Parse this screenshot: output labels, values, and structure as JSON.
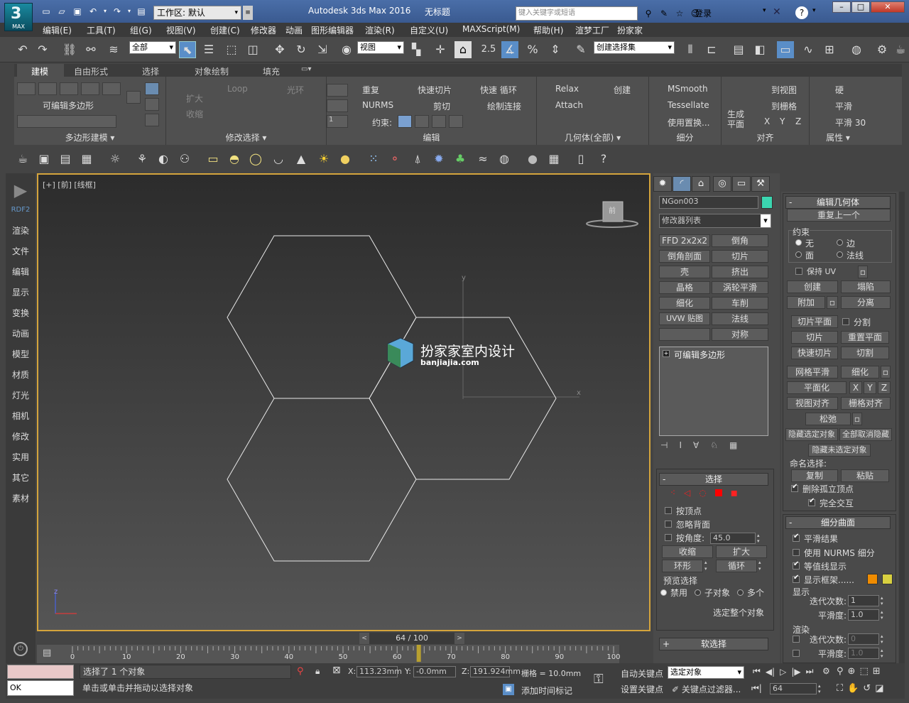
{
  "app": {
    "logo_text": "MAX",
    "title": "Autodesk 3ds Max 2016",
    "document": "无标题",
    "workspace": "工作区: 默认",
    "search_placeholder": "键入关键字或短语",
    "login": "登录"
  },
  "menu": [
    "编辑(E)",
    "工具(T)",
    "组(G)",
    "视图(V)",
    "创建(C)",
    "修改器",
    "动画",
    "图形编辑器",
    "渲染(R)",
    "自定义(U)",
    "MAXScript(M)",
    "帮助(H)",
    "渲梦工厂",
    "扮家家"
  ],
  "toolbar": {
    "filter": "全部",
    "coord": "视图",
    "snap_value": "2.5",
    "named_sel": "创建选择集"
  },
  "ribbon": {
    "tabs": [
      "建模",
      "自由形式",
      "选择",
      "对象绘制",
      "填充"
    ],
    "groups": {
      "poly": "多边形建模",
      "poly_sub": "可编辑多边形",
      "modsel": "修改选择",
      "edit": "编辑",
      "geom": "几何体(全部)",
      "subdiv": "细分",
      "align": "对齐",
      "props": "属性"
    },
    "modsel": {
      "grow": "扩大",
      "shrink": "收缩",
      "loop": "Loop",
      "ring": "光环"
    },
    "edit": {
      "repeat": "重复",
      "quickslice": "快速切片",
      "quickloop": "快速 循环",
      "nurms": "NURMS",
      "cut": "剪切",
      "paintconnect": "绘制连接",
      "constrain": "约束:",
      "spin": "1"
    },
    "geom": {
      "relax": "Relax",
      "create": "创建",
      "attach": "Attach"
    },
    "subdiv": {
      "msmooth": "MSmooth",
      "tessellate": "Tessellate",
      "usedisp": "使用置换..."
    },
    "align": {
      "generate": "生成",
      "plane": "平面",
      "toview": "到视图",
      "togrid": "到栅格",
      "x": "X",
      "y": "Y",
      "z": "Z"
    },
    "props": {
      "hard": "硬",
      "smooth": "平滑",
      "smooth30": "平滑 30"
    }
  },
  "leftbar": [
    "RDF2",
    "渲染",
    "文件",
    "编辑",
    "显示",
    "变换",
    "动画",
    "模型",
    "材质",
    "灯光",
    "相机",
    "修改",
    "实用",
    "其它",
    "素材"
  ],
  "viewport": {
    "label": "[+] [前] [线框]",
    "cube_label": "前",
    "axis_y": "y",
    "axis_x": "x",
    "axis_z": "z",
    "watermark_cn": "扮家家室内设计",
    "watermark_en": "banjiajia.com"
  },
  "cmd": {
    "object_name": "NGon003",
    "object_color": "#3bd6b0",
    "modlist": "修改器列表",
    "modbuttons": [
      "FFD 2x2x2",
      "倒角",
      "倒角剖面",
      "切片",
      "壳",
      "挤出",
      "晶格",
      "涡轮平滑",
      "细化",
      "车削",
      "UVW 贴图",
      "法线",
      "",
      "对称"
    ],
    "stack_item": "可编辑多边形",
    "selection": {
      "title": "选择",
      "by_vertex": "按顶点",
      "ignore_back": "忽略背面",
      "by_angle": "按角度:",
      "angle": "45.0",
      "shrink": "收缩",
      "grow": "扩大",
      "ring": "环形",
      "loop": "循环",
      "preview": "预览选择",
      "disabled": "禁用",
      "subobj": "子对象",
      "multi": "多个",
      "whole": "选定整个对象"
    },
    "soft": "软选择"
  },
  "editgeo": {
    "title": "编辑几何体",
    "repeat": "重复上一个",
    "constraints": "约束",
    "none": "无",
    "edge": "边",
    "face": "面",
    "normal": "法线",
    "keep_uv": "保持 UV",
    "create": "创建",
    "collapse": "塌陷",
    "attach": "附加",
    "detach": "分离",
    "slice_plane": "切片平面",
    "split": "分割",
    "slice": "切片",
    "reset_plane": "重置平面",
    "quickslice": "快速切片",
    "cut": "切割",
    "msmooth": "网格平滑",
    "tessellate": "细化",
    "planar": "平面化",
    "x": "X",
    "y": "Y",
    "z": "Z",
    "view_align": "视图对齐",
    "grid_align": "栅格对齐",
    "relax": "松弛",
    "hide_sel": "隐藏选定对象",
    "unhide_all": "全部取消隐藏",
    "hide_unsel": "隐藏未选定对象",
    "named_sel": "命名选择:",
    "copy": "复制",
    "paste": "粘贴",
    "del_iso": "删除孤立顶点",
    "full_interact": "完全交互"
  },
  "subsurf": {
    "title": "细分曲面",
    "smooth_result": "平滑结果",
    "use_nurms": "使用 NURMS 细分",
    "isoline": "等值线显示",
    "show_cage": "显示框架......",
    "cage_color1": "#f08c00",
    "cage_color2": "#d8d040",
    "display": "显示",
    "iter_label": "迭代次数:",
    "iter": "1",
    "smooth_label": "平滑度:",
    "smooth": "1.0",
    "render": "渲染",
    "r_iter": "0",
    "r_smooth": "1.0"
  },
  "timeline": {
    "frame": "64 / 100",
    "current": 64,
    "max": 100,
    "ticks": [
      "0",
      "10",
      "20",
      "30",
      "40",
      "50",
      "60",
      "70",
      "80",
      "90",
      "100"
    ]
  },
  "status": {
    "prompt_top": "选择了 1 个对象",
    "prompt_bottom": "单击或单击并拖动以选择对象",
    "listener": "OK",
    "x_label": "X:",
    "x": "113.23mm",
    "y_label": "Y:",
    "y": "-0.0mm",
    "z_label": "Z:",
    "z": "191.924mm",
    "grid": "栅格 = 10.0mm",
    "addtime": "添加时间标记",
    "autokey": "自动关键点",
    "setkey": "设置关键点",
    "sel_obj": "选定对象",
    "keyfilter": "关键点过滤器...",
    "frame_field": "64"
  }
}
